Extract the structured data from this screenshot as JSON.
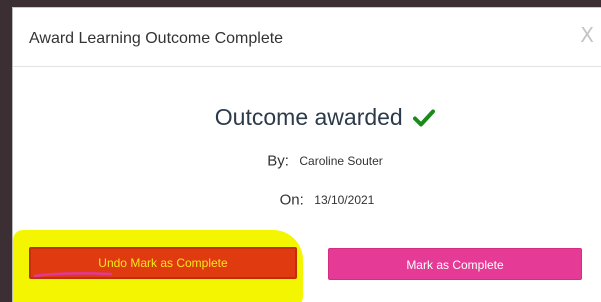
{
  "modal": {
    "title": "Award Learning Outcome Complete",
    "close_label": "X"
  },
  "outcome": {
    "status_text": "Outcome awarded",
    "status_icon": "checkmark-icon",
    "status_icon_color": "#1a8a1a"
  },
  "details": {
    "by_label": "By:",
    "by_value": "Caroline Souter",
    "on_label": "On:",
    "on_value": "13/10/2021"
  },
  "actions": {
    "undo_label": "Undo Mark as Complete",
    "undo_color": "#e03a10",
    "mark_label": "Mark as Complete",
    "mark_color": "#e63a97"
  },
  "annotation": {
    "highlight_color": "#f3f600"
  }
}
